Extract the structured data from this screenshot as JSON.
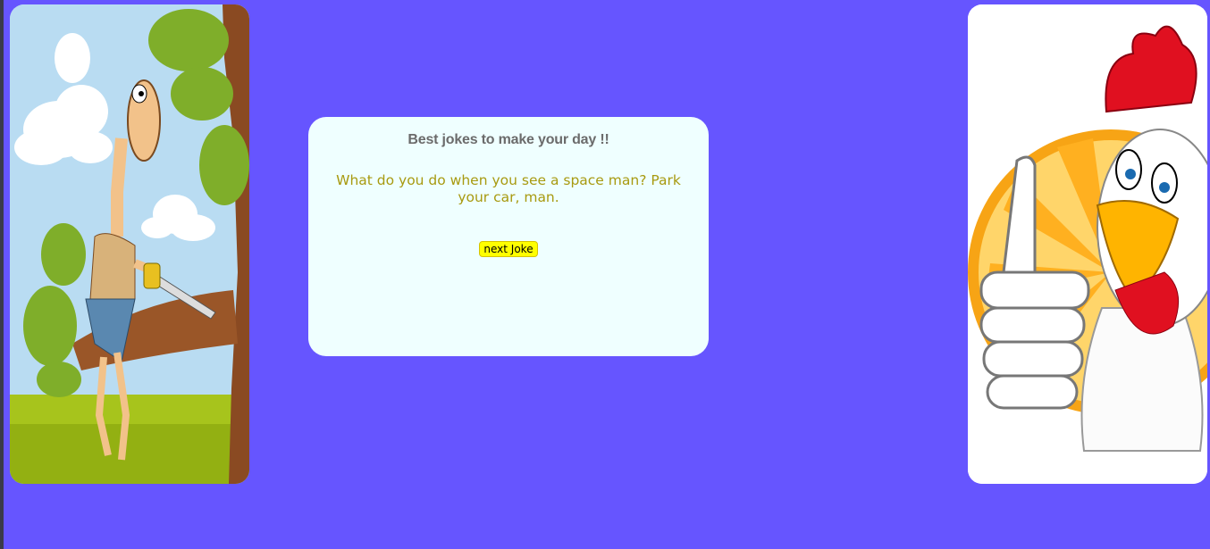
{
  "page": {
    "background_color": "#6655ff"
  },
  "images": {
    "left": {
      "icon": "man-sawing-branch-cartoon-icon"
    },
    "right": {
      "icon": "rooster-thumbs-up-cartoon-icon"
    }
  },
  "joke_card": {
    "heading": "Best jokes to make your day !!",
    "joke": "What do you do when you see a space man? Park your car, man.",
    "next_button_label": "next Joke",
    "background_color": "#efffff",
    "joke_color": "#a89a10",
    "button_color": "#ffff00"
  }
}
